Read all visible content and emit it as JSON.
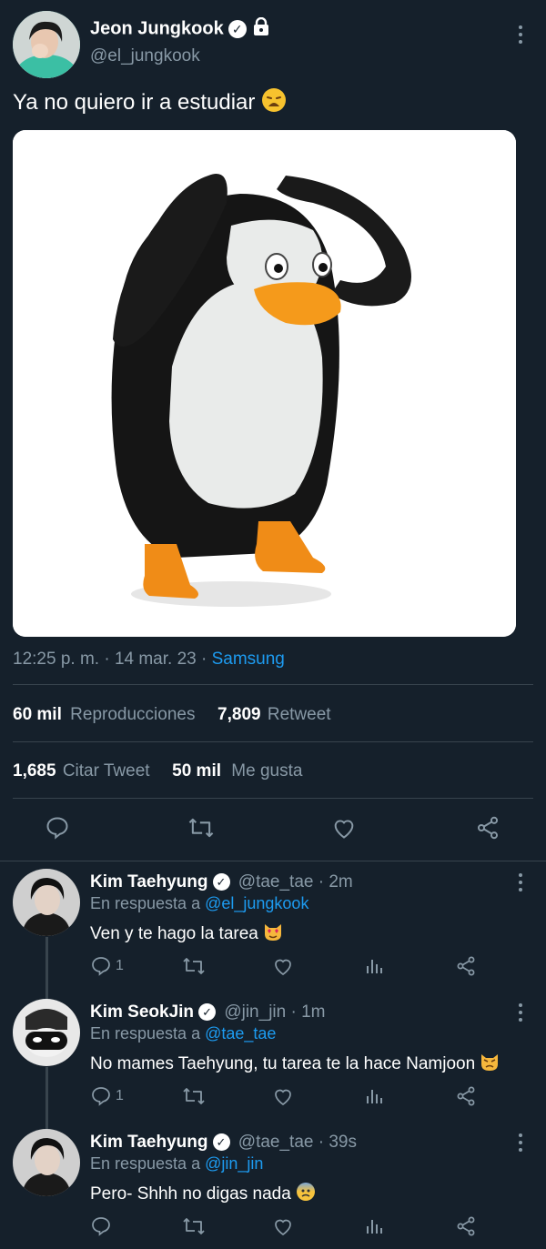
{
  "tweet": {
    "author_name": "Jeon Jungkook",
    "handle": "@el_jungkook",
    "text": "Ya no quiero ir a estudiar",
    "time": "12:25 p. m. · 14 mar. 23 · ",
    "source": "Samsung",
    "views_count": "60 mil",
    "views_label": "Reproducciones",
    "retweets_count": "7,809",
    "retweets_label": "Retweet",
    "quotes_count": "1,685",
    "quotes_label": "Citar Tweet",
    "likes_count": "50 mil",
    "likes_label": "Me gusta"
  },
  "replies": [
    {
      "name": "Kim Taehyung",
      "handle_time": "@tae_tae · 2m",
      "reply_prefix": "En respuesta a ",
      "reply_to": "@el_jungkook",
      "text": "Ven y te hago la tarea",
      "reply_count": "1"
    },
    {
      "name": "Kim SeokJin",
      "handle_time": "@jin_jin · 1m",
      "reply_prefix": "En respuesta a ",
      "reply_to": "@tae_tae",
      "text": "No mames Taehyung, tu tarea te la hace Namjoon",
      "reply_count": "1"
    },
    {
      "name": "Kim Taehyung",
      "handle_time": "@tae_tae · 39s",
      "reply_prefix": "En respuesta a ",
      "reply_to": "@jin_jin",
      "text": "Pero- Shhh no digas nada",
      "reply_count": ""
    }
  ],
  "colors": {
    "background": "#15202b",
    "muted": "#8899a6",
    "link": "#1d9bf0",
    "divider": "#38444d"
  },
  "icons": [
    "verified-icon",
    "lock-icon",
    "more-icon",
    "reply-icon",
    "retweet-icon",
    "like-icon",
    "share-icon",
    "analytics-icon"
  ]
}
